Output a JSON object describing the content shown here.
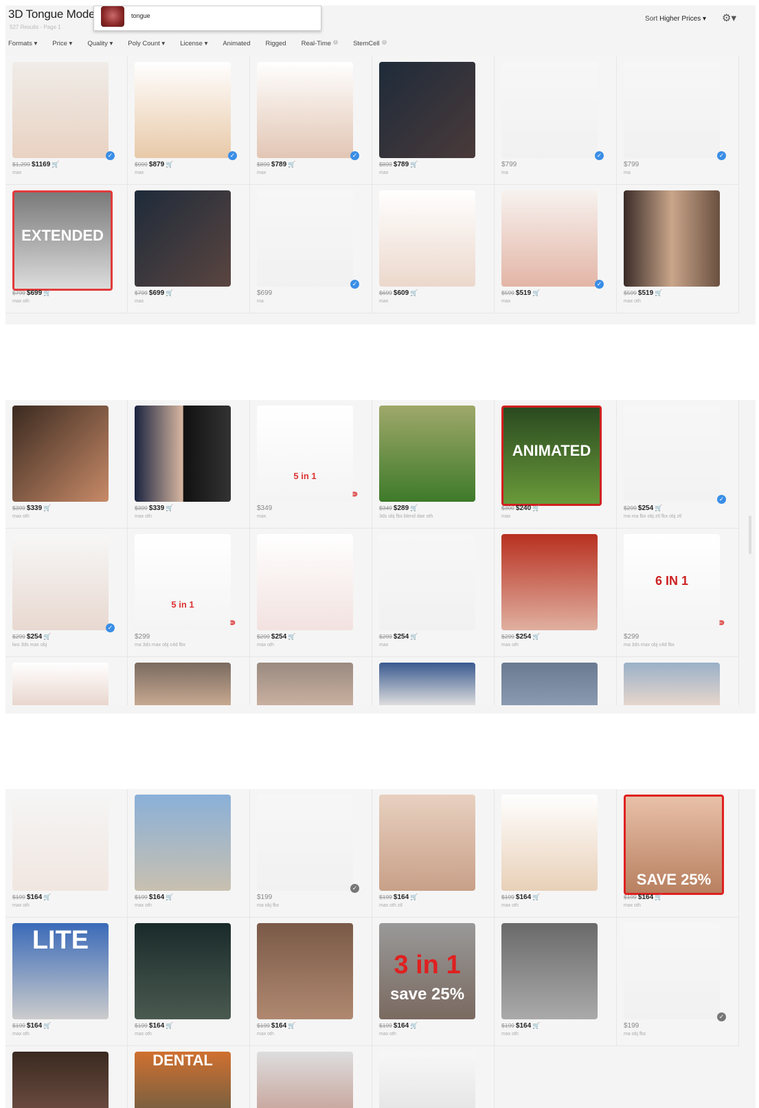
{
  "header": {
    "title": "3D Tongue Mode",
    "subtitle": "527 Results - Page 1",
    "sort_label": "Sort",
    "sort_value": "Higher Prices ▾",
    "search_suggestion": "tongue"
  },
  "filters": [
    {
      "label": "Formats ▾"
    },
    {
      "label": "Price ▾"
    },
    {
      "label": "Quality ▾"
    },
    {
      "label": "Poly Count ▾"
    },
    {
      "label": "License ▾"
    },
    {
      "label": "Animated"
    },
    {
      "label": "Rigged"
    },
    {
      "label": "Real-Time"
    },
    {
      "label": "StemCell"
    }
  ],
  "section1": [
    {
      "old": "$1,299",
      "new": "$1169",
      "fmt": "max",
      "check": true,
      "bg": "linear-gradient(#f0ece8,#e9d2c2)",
      "fg": "#4a3a30"
    },
    {
      "old": "$999",
      "new": "$879",
      "fmt": "max",
      "check": true,
      "bg": "linear-gradient(#fff,#e8c9a8)",
      "fg": "#8a6a40"
    },
    {
      "old": "$899",
      "new": "$789",
      "fmt": "max",
      "check": true,
      "bg": "linear-gradient(#fff,#e2c6b4)",
      "fg": "#333"
    },
    {
      "old": "$899",
      "new": "$789",
      "fmt": "max",
      "check": false,
      "bg": "linear-gradient(135deg,#1e2b3a,#4a3a3a)",
      "fg": "#c9a090"
    },
    {
      "old": "",
      "new": "$799",
      "fmt": "ma",
      "check": true,
      "bg": "linear-gradient(#f7f7f7,#f1f1f1)",
      "fg": "#9a6a30"
    },
    {
      "old": "",
      "new": "$799",
      "fmt": "ma",
      "check": true,
      "bg": "linear-gradient(#f7f7f7,#f1f1f1)",
      "fg": "#9a6a30"
    },
    {
      "old": "$799",
      "new": "$699",
      "fmt": "max oth",
      "check": false,
      "bg": "linear-gradient(#7a7a7a,#dcdcdc)",
      "fg": "#fff",
      "label": "EXTENDED",
      "border": "#e23a3a"
    },
    {
      "old": "$799",
      "new": "$699",
      "fmt": "max",
      "check": false,
      "bg": "linear-gradient(135deg,#1e2b3a,#5a4540)",
      "fg": "#c9a090"
    },
    {
      "old": "",
      "new": "$699",
      "fmt": "ma",
      "check": true,
      "bg": "linear-gradient(#f7f7f7,#f1f1f1)",
      "fg": "#9a6a30"
    },
    {
      "old": "$699",
      "new": "$609",
      "fmt": "max",
      "check": false,
      "bg": "linear-gradient(#fff,#ecd8cc)",
      "fg": "#d08a8a"
    },
    {
      "old": "$599",
      "new": "$519",
      "fmt": "max",
      "check": true,
      "bg": "linear-gradient(#f7f2ef,#e3b5a6)",
      "fg": "#b5666a"
    },
    {
      "old": "$599",
      "new": "$519",
      "fmt": "max oth",
      "check": false,
      "bg": "linear-gradient(90deg,#3a2c28,#c9a58a 50%,#6a5040)",
      "fg": "#fff"
    }
  ],
  "section2": [
    {
      "old": "$399",
      "new": "$339",
      "fmt": "max oth",
      "check": false,
      "bg": "linear-gradient(135deg,#3a2a20,#c88a68)",
      "fg": "#fff"
    },
    {
      "old": "$399",
      "new": "$339",
      "fmt": "max oth",
      "check": false,
      "bg": "linear-gradient(90deg,#1a2440,#d7b6a0 50%,#111 51%,#333)",
      "fg": "#fff"
    },
    {
      "old": "",
      "new": "$349",
      "fmt": "max",
      "check": false,
      "bg": "linear-gradient(#fff,#f4f4f4)",
      "fg": "#6a9a30",
      "label": "5 in 1",
      "labelColor": "#d33",
      "magnet": true
    },
    {
      "old": "$349",
      "new": "$289",
      "fmt": "3ds obj fbx blend dae oth",
      "check": false,
      "bg": "linear-gradient(#9fa86a,#3e7a2a)",
      "fg": "#fff"
    },
    {
      "old": "$300",
      "new": "$240",
      "fmt": "max",
      "check": false,
      "bg": "linear-gradient(#2a4a20,#6a9a3a)",
      "fg": "#fff",
      "label": "ANIMATED",
      "border": "#d02020"
    },
    {
      "old": "$299",
      "new": "$254",
      "fmt": "ma ma fbx obj ztl fbx obj ztl",
      "check": true,
      "bg": "linear-gradient(#f7f7f7,#f2f2f2)",
      "fg": "#b0404a"
    },
    {
      "old": "$299",
      "new": "$254",
      "fmt": "lwo 3ds max obj",
      "check": true,
      "bg": "linear-gradient(#f7f7f7,#e8d8d0)",
      "fg": "#8a2a20"
    },
    {
      "old": "",
      "new": "$299",
      "fmt": "ma 3ds max obj c4d fbx",
      "check": false,
      "bg": "linear-gradient(#fff,#f4f4f4)",
      "fg": "#6a9a30",
      "label": "5 in 1",
      "labelColor": "#d33",
      "magnet": true
    },
    {
      "old": "$299",
      "new": "$254",
      "fmt": "max oth",
      "check": false,
      "bg": "linear-gradient(#fff,#f2e2e0)",
      "fg": "#b04060"
    },
    {
      "old": "$299",
      "new": "$254",
      "fmt": "max",
      "check": false,
      "bg": "linear-gradient(#f7f7f7,#f1f1f1)",
      "fg": "#b0505a"
    },
    {
      "old": "$299",
      "new": "$254",
      "fmt": "max oth",
      "check": false,
      "bg": "linear-gradient(#b83020,#e0b0a0)",
      "fg": "#fff"
    },
    {
      "old": "",
      "new": "$299",
      "fmt": "ma 3ds max obj c4d fbx",
      "check": false,
      "bg": "linear-gradient(#fff,#f4f4f4)",
      "fg": "#6a9a30",
      "label": "6 IN 1",
      "labelColor": "#c22",
      "magnet": true
    }
  ],
  "section2_partial": [
    {
      "bg": "linear-gradient(#fff,#e9d6ce)"
    },
    {
      "bg": "linear-gradient(#7a6a60,#c7a890)"
    },
    {
      "bg": "linear-gradient(#9a8a80,#c9b0a0)"
    },
    {
      "bg": "linear-gradient(#3a5a90,#ddd)"
    },
    {
      "bg": "linear-gradient(#6a7a90,#8a9ab0)"
    },
    {
      "bg": "linear-gradient(#9ab0c8,#e6d6cc)"
    }
  ],
  "section3": [
    {
      "old": "$199",
      "new": "$164",
      "fmt": "max oth",
      "check": false,
      "bg": "linear-gradient(#f5f5f5,#f1e6e0)",
      "fg": "#6a4a40"
    },
    {
      "old": "$199",
      "new": "$164",
      "fmt": "max oth",
      "check": false,
      "bg": "linear-gradient(#8ab0d8,#c8c0b0)",
      "fg": "#333"
    },
    {
      "old": "",
      "new": "$199",
      "fmt": "ma obj fbx",
      "check": true,
      "grey": true,
      "bg": "linear-gradient(#f7f7f7,#f1f1f1)",
      "fg": "#9a6a30"
    },
    {
      "old": "$199",
      "new": "$164",
      "fmt": "max oth ztl",
      "check": false,
      "bg": "linear-gradient(#e8d0c0,#c8a088)",
      "fg": "#6a5040"
    },
    {
      "old": "$199",
      "new": "$164",
      "fmt": "max oth",
      "check": false,
      "bg": "linear-gradient(#fff,#e8d0b8)",
      "fg": "#4a3020"
    },
    {
      "old": "$199",
      "new": "$164",
      "fmt": "max oth",
      "check": false,
      "bg": "linear-gradient(#e8c0a8,#b88060)",
      "fg": "#fff",
      "label": "SAVE 25%",
      "border": "#e02020"
    },
    {
      "old": "$199",
      "new": "$164",
      "fmt": "max oth",
      "check": false,
      "bg": "linear-gradient(#3a6ab8,#ccc)",
      "fg": "#fff",
      "label": "LITE"
    },
    {
      "old": "$199",
      "new": "$164",
      "fmt": "max oth",
      "check": false,
      "bg": "linear-gradient(#1a2a2a,#4a5a50)",
      "fg": "#fff"
    },
    {
      "old": "$199",
      "new": "$164",
      "fmt": "max oth",
      "check": false,
      "bg": "linear-gradient(#7a5a48,#b08870)",
      "fg": "#fff"
    },
    {
      "old": "$199",
      "new": "$164",
      "fmt": "max oth",
      "check": false,
      "bg": "linear-gradient(#999,#7a6a60)",
      "fg": "#fff",
      "label": "3 in 1",
      "sublabel": "save 25%"
    },
    {
      "old": "$199",
      "new": "$164",
      "fmt": "max oth",
      "check": false,
      "bg": "linear-gradient(#6a6a6a,#aaa)",
      "fg": "#fff"
    },
    {
      "old": "",
      "new": "$199",
      "fmt": "ma obj fbx",
      "check": true,
      "grey": true,
      "bg": "linear-gradient(#f7f7f7,#f1f1f1)",
      "fg": "#333"
    }
  ],
  "section3_partial": [
    {
      "bg": "linear-gradient(#3a2a20,#6a4a40)",
      "label": ""
    },
    {
      "bg": "linear-gradient(#d07030,#7a6040)",
      "label": "DENTAL"
    },
    {
      "bg": "linear-gradient(#ddd,#c9a8a0)",
      "label": ""
    },
    {
      "bg": "linear-gradient(#f7f7f7,#e6e6e6)",
      "label": ""
    }
  ],
  "colors": {
    "accent": "#3a8ee6",
    "cart": "#6db33f",
    "panel": "#f4f4f4"
  },
  "icons": {
    "cart": "cart-icon",
    "check": "verified-check-icon",
    "gear": "gear-icon",
    "info": "info-icon",
    "magnet": "stemcell-magnet-icon"
  }
}
